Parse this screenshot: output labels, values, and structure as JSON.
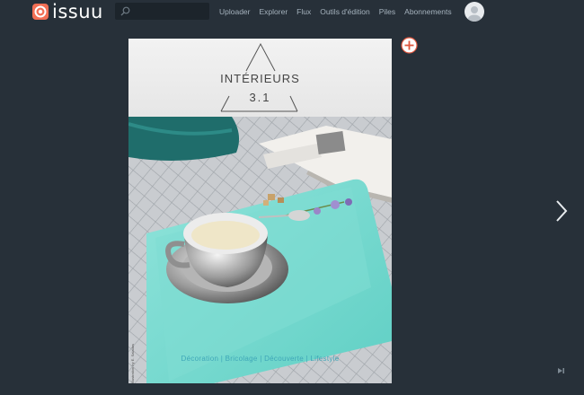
{
  "brand": {
    "name": "issuu",
    "accent": "#f26f55"
  },
  "search": {
    "placeholder": "",
    "value": "",
    "icon": "search-icon"
  },
  "nav": {
    "items": [
      {
        "label": "Uploader"
      },
      {
        "label": "Explorer"
      },
      {
        "label": "Flux"
      },
      {
        "label": "Outils d'édition"
      },
      {
        "label": "Piles"
      },
      {
        "label": "Abonnements"
      }
    ]
  },
  "user": {
    "avatar_icon": "user-avatar-icon"
  },
  "document": {
    "title": "INTÉRIEURS",
    "issue": "3.1",
    "tagline": "Décoration | Bricolage | Découverte | Lifestyle",
    "credit": "Illustration by E. Saladas"
  },
  "controls": {
    "add_icon": "add-to-stack-icon",
    "next_icon": "chevron-right-icon",
    "end_icon": "skip-to-end-icon"
  },
  "colors": {
    "background": "#273039",
    "nav_text": "#a5b2bd",
    "tagline": "#3fa7b8"
  }
}
